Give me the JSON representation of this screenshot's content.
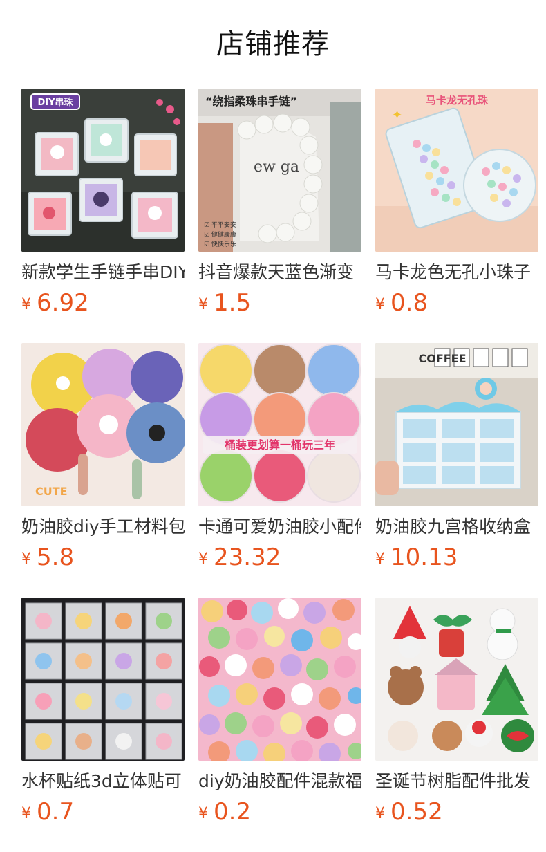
{
  "page": {
    "title": "店铺推荐"
  },
  "currency_symbol": "¥",
  "products": [
    {
      "name": "新款学生手链手串DIY",
      "price": "6.92",
      "badge": "DIY串珠"
    },
    {
      "name": "抖音爆款天蓝色渐变",
      "price": "1.5",
      "badge": "“绕指柔珠串手链”"
    },
    {
      "name": "马卡龙色无孔小珠子",
      "price": "0.8",
      "badge": "马卡龙无孔珠"
    },
    {
      "name": "奶油胶diy手工材料包",
      "price": "5.8",
      "badge": "CUTE"
    },
    {
      "name": "卡通可爱奶油胶小配件",
      "price": "23.32",
      "badge": "桶装更划算一桶玩三年"
    },
    {
      "name": "奶油胶九宫格收纳盒",
      "price": "10.13",
      "badge": "COFFEE"
    },
    {
      "name": "水杯贴纸3d立体贴可",
      "price": "0.7",
      "badge": ""
    },
    {
      "name": "diy奶油胶配件混款福",
      "price": "0.2",
      "badge": ""
    },
    {
      "name": "圣诞节树脂配件批发",
      "price": "0.52",
      "badge": ""
    }
  ]
}
